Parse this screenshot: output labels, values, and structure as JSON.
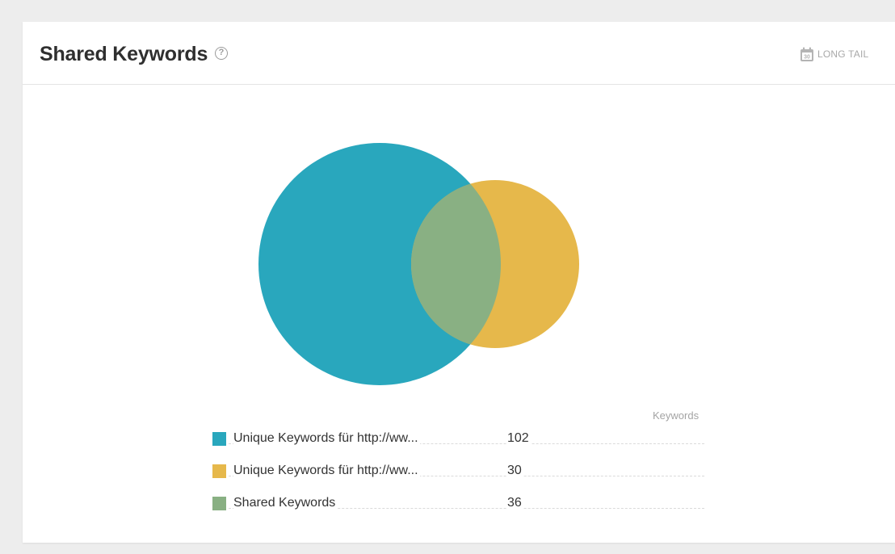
{
  "header": {
    "title": "Shared Keywords",
    "help_icon": "?",
    "long_tail_label": "LONG TAIL",
    "calendar_icon_text": "30"
  },
  "colors": {
    "unique_a": "#29a7bd",
    "unique_b": "#e6b84b",
    "shared": "#89b083"
  },
  "legend": {
    "column_header": "Keywords",
    "items": [
      {
        "label": "Unique Keywords für http://ww...",
        "value": "102",
        "color": "#29a7bd"
      },
      {
        "label": "Unique Keywords für http://ww...",
        "value": "30",
        "color": "#e6b84b"
      },
      {
        "label": "Shared Keywords",
        "value": "36",
        "color": "#89b083"
      }
    ]
  }
}
